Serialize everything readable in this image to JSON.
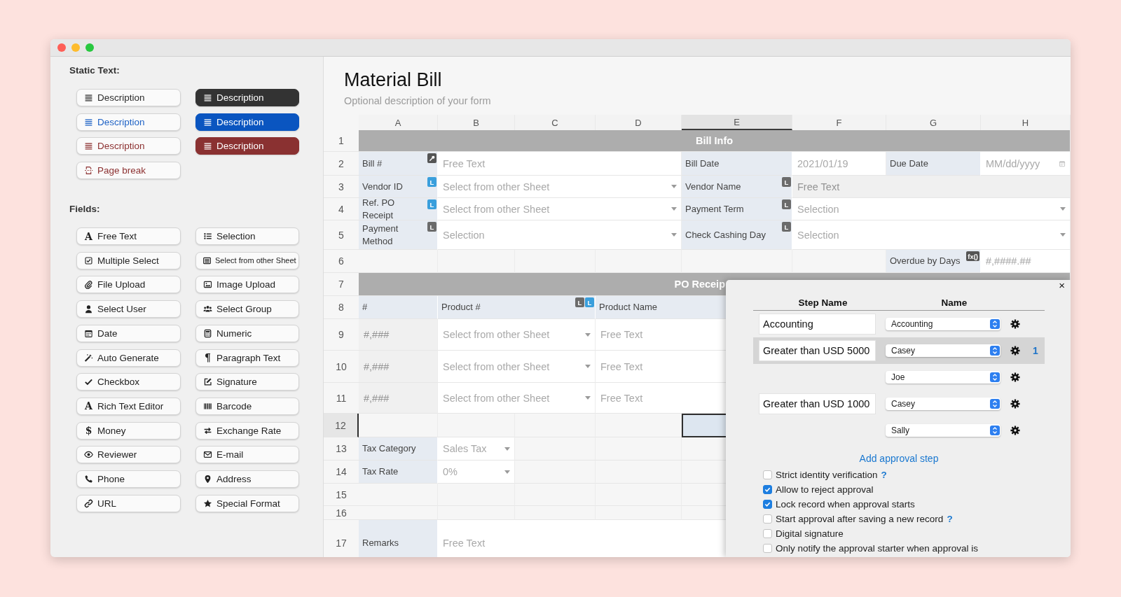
{
  "palette": {
    "static_text": {
      "heading": "Static Text:",
      "items": [
        {
          "kind": "description",
          "label": "Description",
          "color": "#2b2b2b",
          "filled": false
        },
        {
          "kind": "description",
          "label": "Description",
          "color": "#333333",
          "filled": true
        },
        {
          "kind": "description",
          "label": "Description",
          "color": "#1f63c6",
          "filled": false
        },
        {
          "kind": "description",
          "label": "Description",
          "color": "#0a55c0",
          "filled": true
        },
        {
          "kind": "description",
          "label": "Description",
          "color": "#8c3030",
          "filled": false
        },
        {
          "kind": "description",
          "label": "Description",
          "color": "#8a3131",
          "filled": true
        },
        {
          "kind": "page-break",
          "label": "Page break",
          "color": "#8c3030",
          "filled": false
        }
      ]
    },
    "fields": {
      "heading": "Fields:",
      "items": [
        {
          "kind": "free-text",
          "glyph": "A",
          "label": "Free Text"
        },
        {
          "kind": "selection",
          "label": "Selection"
        },
        {
          "kind": "multiple-select",
          "label": "Multiple Select"
        },
        {
          "kind": "select-sheet",
          "label": "Select from other Sheet"
        },
        {
          "kind": "file-upload",
          "label": "File Upload"
        },
        {
          "kind": "image-upload",
          "label": "Image Upload"
        },
        {
          "kind": "select-user",
          "label": "Select User"
        },
        {
          "kind": "select-group",
          "label": "Select Group"
        },
        {
          "kind": "date",
          "label": "Date"
        },
        {
          "kind": "numeric",
          "label": "Numeric"
        },
        {
          "kind": "auto-generate",
          "label": "Auto Generate"
        },
        {
          "kind": "paragraph",
          "glyph": "¶",
          "label": "Paragraph Text"
        },
        {
          "kind": "checkbox",
          "label": "Checkbox"
        },
        {
          "kind": "signature",
          "label": "Signature"
        },
        {
          "kind": "rich-text",
          "glyph": "A",
          "label": "Rich Text Editor"
        },
        {
          "kind": "barcode",
          "label": "Barcode"
        },
        {
          "kind": "money",
          "glyph": "$",
          "label": "Money"
        },
        {
          "kind": "exchange",
          "label": "Exchange Rate"
        },
        {
          "kind": "reviewer",
          "label": "Reviewer"
        },
        {
          "kind": "email",
          "label": "E-mail"
        },
        {
          "kind": "phone",
          "label": "Phone"
        },
        {
          "kind": "address",
          "label": "Address"
        },
        {
          "kind": "url",
          "label": "URL"
        },
        {
          "kind": "special-format",
          "label": "Special Format"
        }
      ]
    }
  },
  "form": {
    "title": "Material Bill",
    "description": "Optional description of your form",
    "columns": [
      {
        "label": "A",
        "selected": false
      },
      {
        "label": "B",
        "selected": false
      },
      {
        "label": "C",
        "selected": false
      },
      {
        "label": "D",
        "selected": false
      },
      {
        "label": "E",
        "selected": true
      },
      {
        "label": "F",
        "selected": false
      },
      {
        "label": "G",
        "selected": false
      },
      {
        "label": "H",
        "selected": false
      }
    ],
    "rows": [
      {
        "number": "1",
        "selected": false,
        "cells": [
          {
            "kind": "section",
            "text": "Bill Info"
          }
        ]
      },
      {
        "number": "2",
        "selected": false,
        "cells": [
          {
            "kind": "label",
            "text": "Bill #",
            "badges": [
              {
                "kind": "key",
                "color": "#555555"
              }
            ]
          },
          {
            "kind": "text",
            "placeholder": "Free Text"
          },
          "",
          "",
          {
            "kind": "label",
            "text": "Bill Date"
          },
          {
            "kind": "text",
            "placeholder": "2021/01/19"
          },
          {
            "kind": "label",
            "text": "Due Date"
          },
          {
            "kind": "date",
            "placeholder": "MM/dd/yyyy"
          }
        ]
      },
      {
        "number": "3",
        "selected": false,
        "cells": [
          {
            "kind": "label",
            "text": "Vendor ID",
            "badges": [
              {
                "kind": "text",
                "text": "L",
                "color": "#3a9fdc"
              }
            ]
          },
          {
            "kind": "select",
            "placeholder": "Select from other Sheet"
          },
          "",
          "",
          {
            "kind": "label",
            "text": "Vendor Name",
            "badges": [
              {
                "kind": "text",
                "text": "L",
                "color": "#6b6b6b"
              }
            ]
          },
          {
            "kind": "readonly",
            "placeholder": "Free Text"
          }
        ]
      },
      {
        "number": "4",
        "selected": false,
        "cells": [
          {
            "kind": "label",
            "text": "Ref. PO Receipt",
            "badges": [
              {
                "kind": "text",
                "text": "L",
                "color": "#3a9fdc"
              }
            ]
          },
          {
            "kind": "select",
            "placeholder": "Select from other Sheet"
          },
          "",
          "",
          {
            "kind": "label",
            "text": "Payment Term",
            "badges": [
              {
                "kind": "text",
                "text": "L",
                "color": "#6b6b6b"
              }
            ]
          },
          {
            "kind": "select",
            "placeholder": "Selection"
          }
        ]
      },
      {
        "number": "5",
        "selected": false,
        "cells": [
          {
            "kind": "label",
            "text": "Payment Method",
            "badges": [
              {
                "kind": "text",
                "text": "L",
                "color": "#6b6b6b"
              }
            ]
          },
          {
            "kind": "select",
            "placeholder": "Selection"
          },
          "",
          "",
          {
            "kind": "label",
            "text": "Check Cashing Day",
            "badges": [
              {
                "kind": "text",
                "text": "L",
                "color": "#6b6b6b"
              }
            ]
          },
          {
            "kind": "select",
            "placeholder": "Selection"
          }
        ]
      },
      {
        "number": "6",
        "selected": false,
        "cells": [
          "",
          "",
          "",
          "",
          "",
          "",
          {
            "kind": "label",
            "text": "Overdue by Days",
            "badges": [
              {
                "kind": "text",
                "text": "fx()",
                "color": "#555555"
              }
            ]
          },
          {
            "kind": "text",
            "placeholder": "#,####.##"
          }
        ]
      },
      {
        "number": "7",
        "selected": false,
        "cells": [
          {
            "kind": "section",
            "text": "PO Receip"
          }
        ]
      },
      {
        "number": "8",
        "selected": false,
        "cells": [
          {
            "kind": "label",
            "text": "#"
          },
          {
            "kind": "label",
            "text": "Product #",
            "badges": [
              {
                "kind": "text",
                "text": "L",
                "color": "#6b6b6b"
              },
              {
                "kind": "text",
                "text": "L",
                "color": "#3a9fdc"
              }
            ]
          },
          "",
          {
            "kind": "label",
            "text": "Product Name"
          }
        ]
      },
      {
        "number": "9",
        "selected": false,
        "cells": [
          {
            "kind": "number",
            "placeholder": "#,###"
          },
          {
            "kind": "select",
            "placeholder": "Select from other Sheet"
          },
          "",
          {
            "kind": "text",
            "placeholder": "Free Text"
          }
        ]
      },
      {
        "number": "10",
        "selected": false,
        "cells": [
          {
            "kind": "number",
            "placeholder": "#,###"
          },
          {
            "kind": "select",
            "placeholder": "Select from other Sheet"
          },
          "",
          {
            "kind": "text",
            "placeholder": "Free Text"
          }
        ]
      },
      {
        "number": "11",
        "selected": false,
        "cells": [
          {
            "kind": "number",
            "placeholder": "#,###"
          },
          {
            "kind": "select",
            "placeholder": "Select from other Sheet"
          },
          "",
          {
            "kind": "text",
            "placeholder": "Free Text"
          }
        ]
      },
      {
        "number": "12",
        "selected": true,
        "cells": []
      },
      {
        "number": "13",
        "selected": false,
        "cells": [
          {
            "kind": "label",
            "text": "Tax Category"
          },
          {
            "kind": "select",
            "placeholder": "Sales Tax"
          }
        ]
      },
      {
        "number": "14",
        "selected": false,
        "cells": [
          {
            "kind": "label",
            "text": "Tax Rate"
          },
          {
            "kind": "select",
            "placeholder": "0%"
          }
        ]
      },
      {
        "number": "15",
        "selected": false,
        "cells": []
      },
      {
        "number": "16",
        "selected": false,
        "cells": []
      },
      {
        "number": "17",
        "selected": false,
        "cells": [
          {
            "kind": "label",
            "text": "Remarks"
          },
          {
            "kind": "text",
            "placeholder": "Free Text"
          }
        ]
      }
    ]
  },
  "approval_dialog": {
    "close": "×",
    "headers": [
      "Step Name",
      "Name"
    ],
    "rows": [
      {
        "step_name": "Accounting",
        "approver": "Accounting",
        "selected": false
      },
      {
        "step_name": "Greater than USD 5000",
        "approver": "Casey",
        "selected": true,
        "count": "1"
      },
      {
        "approver": "Joe",
        "selected": false
      },
      {
        "step_name": "Greater than USD 1000",
        "approver": "Casey",
        "selected": false
      },
      {
        "approver": "Sally",
        "selected": false
      }
    ],
    "add_step": "Add approval step",
    "options": [
      {
        "label": "Strict identity verification",
        "checked": false,
        "help": "?"
      },
      {
        "label": "Allow to reject approval",
        "checked": true
      },
      {
        "label": "Lock record when approval starts",
        "checked": true
      },
      {
        "label": "Start approval after saving a new record",
        "checked": false,
        "help": "?"
      },
      {
        "label": "Digital signature",
        "checked": false
      },
      {
        "label": "Only notify the approval starter when approval is",
        "checked": false
      }
    ]
  }
}
